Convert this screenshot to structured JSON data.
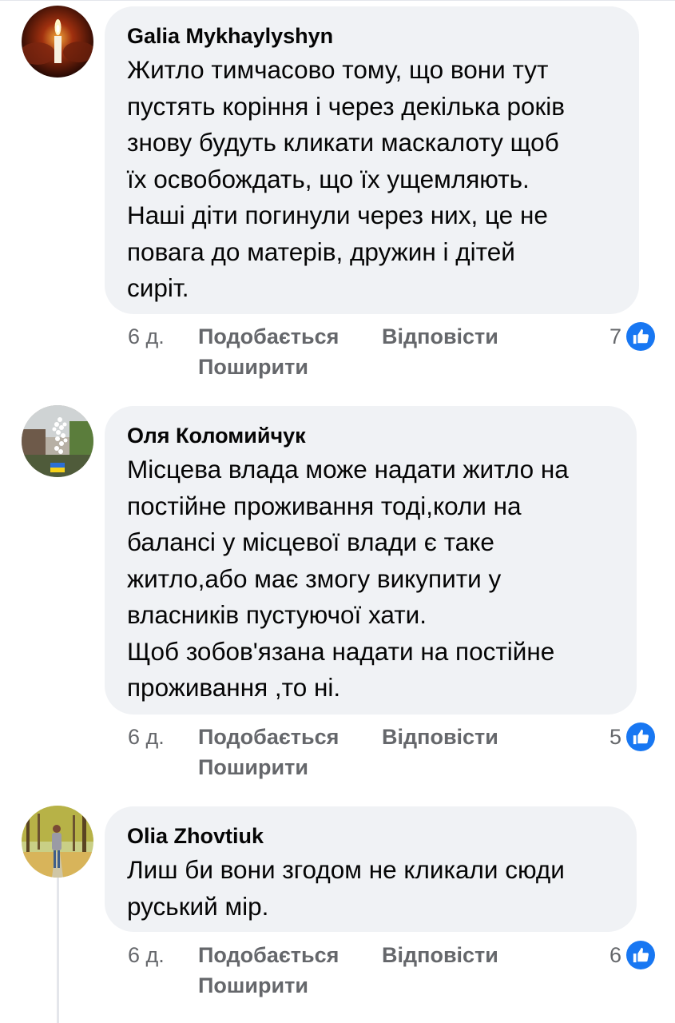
{
  "colors": {
    "bubble_bg": "#f0f2f5",
    "meta_text": "#65676b",
    "like_blue": "#1877f2"
  },
  "comments": [
    {
      "author": "Galia Mykhaylyshyn",
      "avatar_icon": "candle-avatar",
      "text": "Житло тимчасово тому, що вони тут\nпустять коріння і через декілька років\nзнову будуть кликати маскалоту щоб\nїх освобождать, що їх ущемляють.\nНаші діти погинули через них, це не\nповага до матерів, дружин і дітей\nсиріт.",
      "time": "6 д.",
      "like_label": "Подобається",
      "reply_label": "Відповісти",
      "share_label": "Поширити",
      "reaction_count": "7",
      "reaction_icon": "thumbs-up-icon"
    },
    {
      "author": "Оля Коломийчук",
      "avatar_icon": "flowers-avatar",
      "text": "Місцева влада може надати житло на\nпостійне проживання тоді,коли на\nбалансі у місцевої влади є таке\nжитло,або має змогу викупити у\nвласників пустуючої хати.\nЩоб зобов'язана надати на постійне\nпроживання ,то ні.",
      "time": "6 д.",
      "like_label": "Подобається",
      "reply_label": "Відповісти",
      "share_label": "Поширити",
      "reaction_count": "5",
      "reaction_icon": "thumbs-up-icon"
    },
    {
      "author": "Olia Zhovtiuk",
      "avatar_icon": "autumn-park-avatar",
      "text": "Лиш би вони згодом не кликали сюди\nруський мір.",
      "time": "6 д.",
      "like_label": "Подобається",
      "reply_label": "Відповісти",
      "share_label": "Поширити",
      "reaction_count": "6",
      "reaction_icon": "thumbs-up-icon"
    }
  ]
}
